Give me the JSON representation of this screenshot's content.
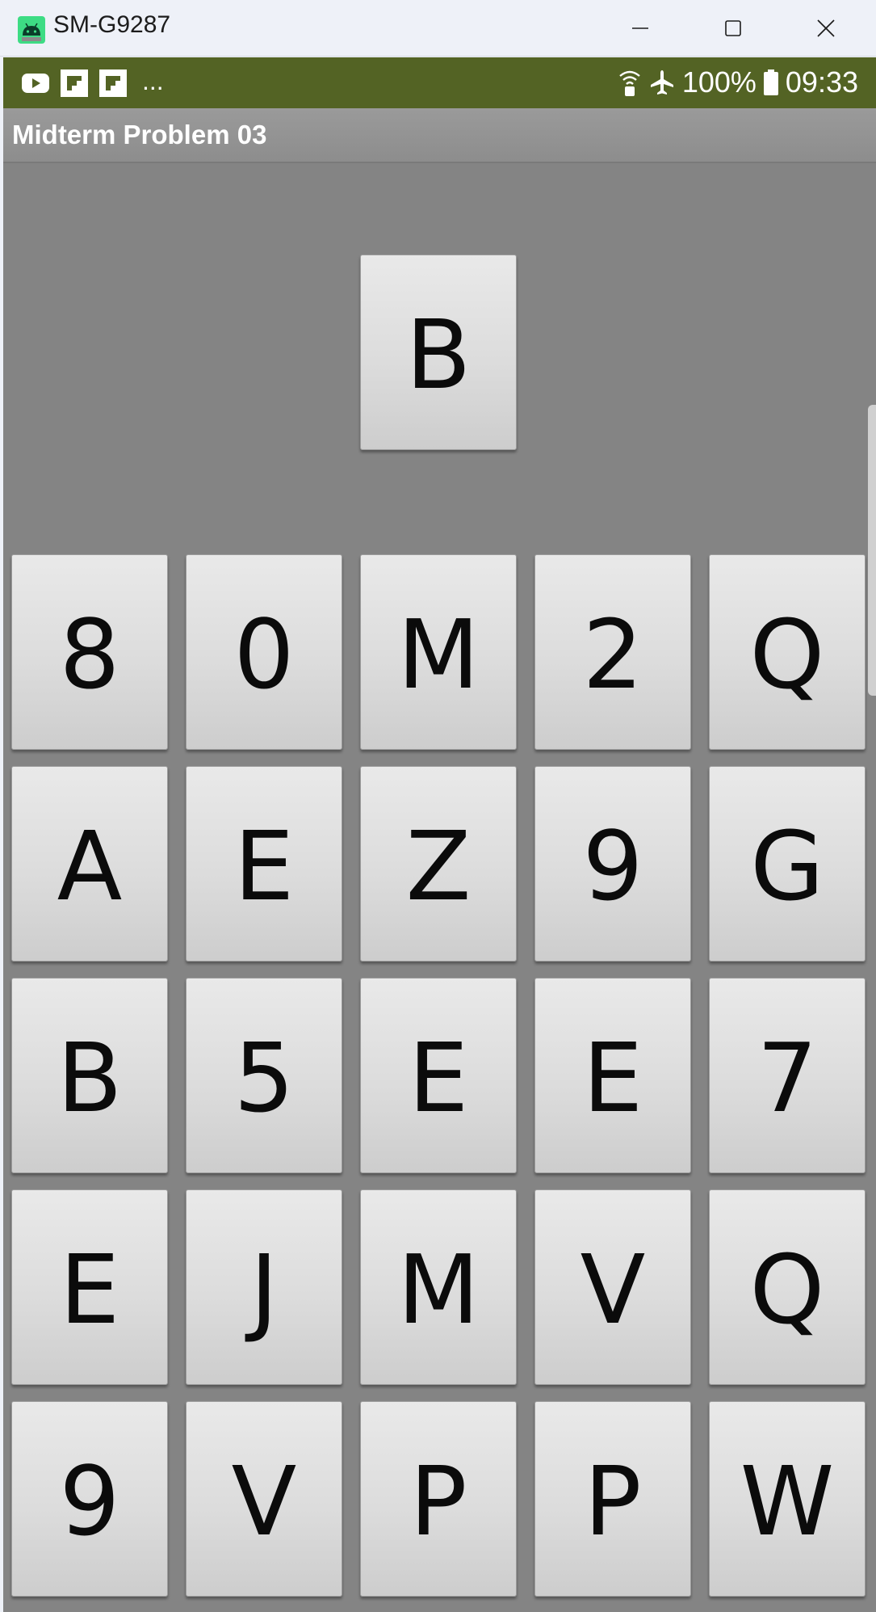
{
  "window": {
    "title": "SM-G9287"
  },
  "statusbar": {
    "more": "...",
    "battery": "100%",
    "time": "09:33"
  },
  "app": {
    "title": "Midterm Problem 03"
  },
  "target": {
    "letter": "B"
  },
  "grid": [
    [
      "8",
      "0",
      "M",
      "2",
      "Q"
    ],
    [
      "A",
      "E",
      "Z",
      "9",
      "G"
    ],
    [
      "B",
      "5",
      "E",
      "E",
      "7"
    ],
    [
      "E",
      "J",
      "M",
      "V",
      "Q"
    ],
    [
      "9",
      "V",
      "P",
      "P",
      "W"
    ]
  ]
}
